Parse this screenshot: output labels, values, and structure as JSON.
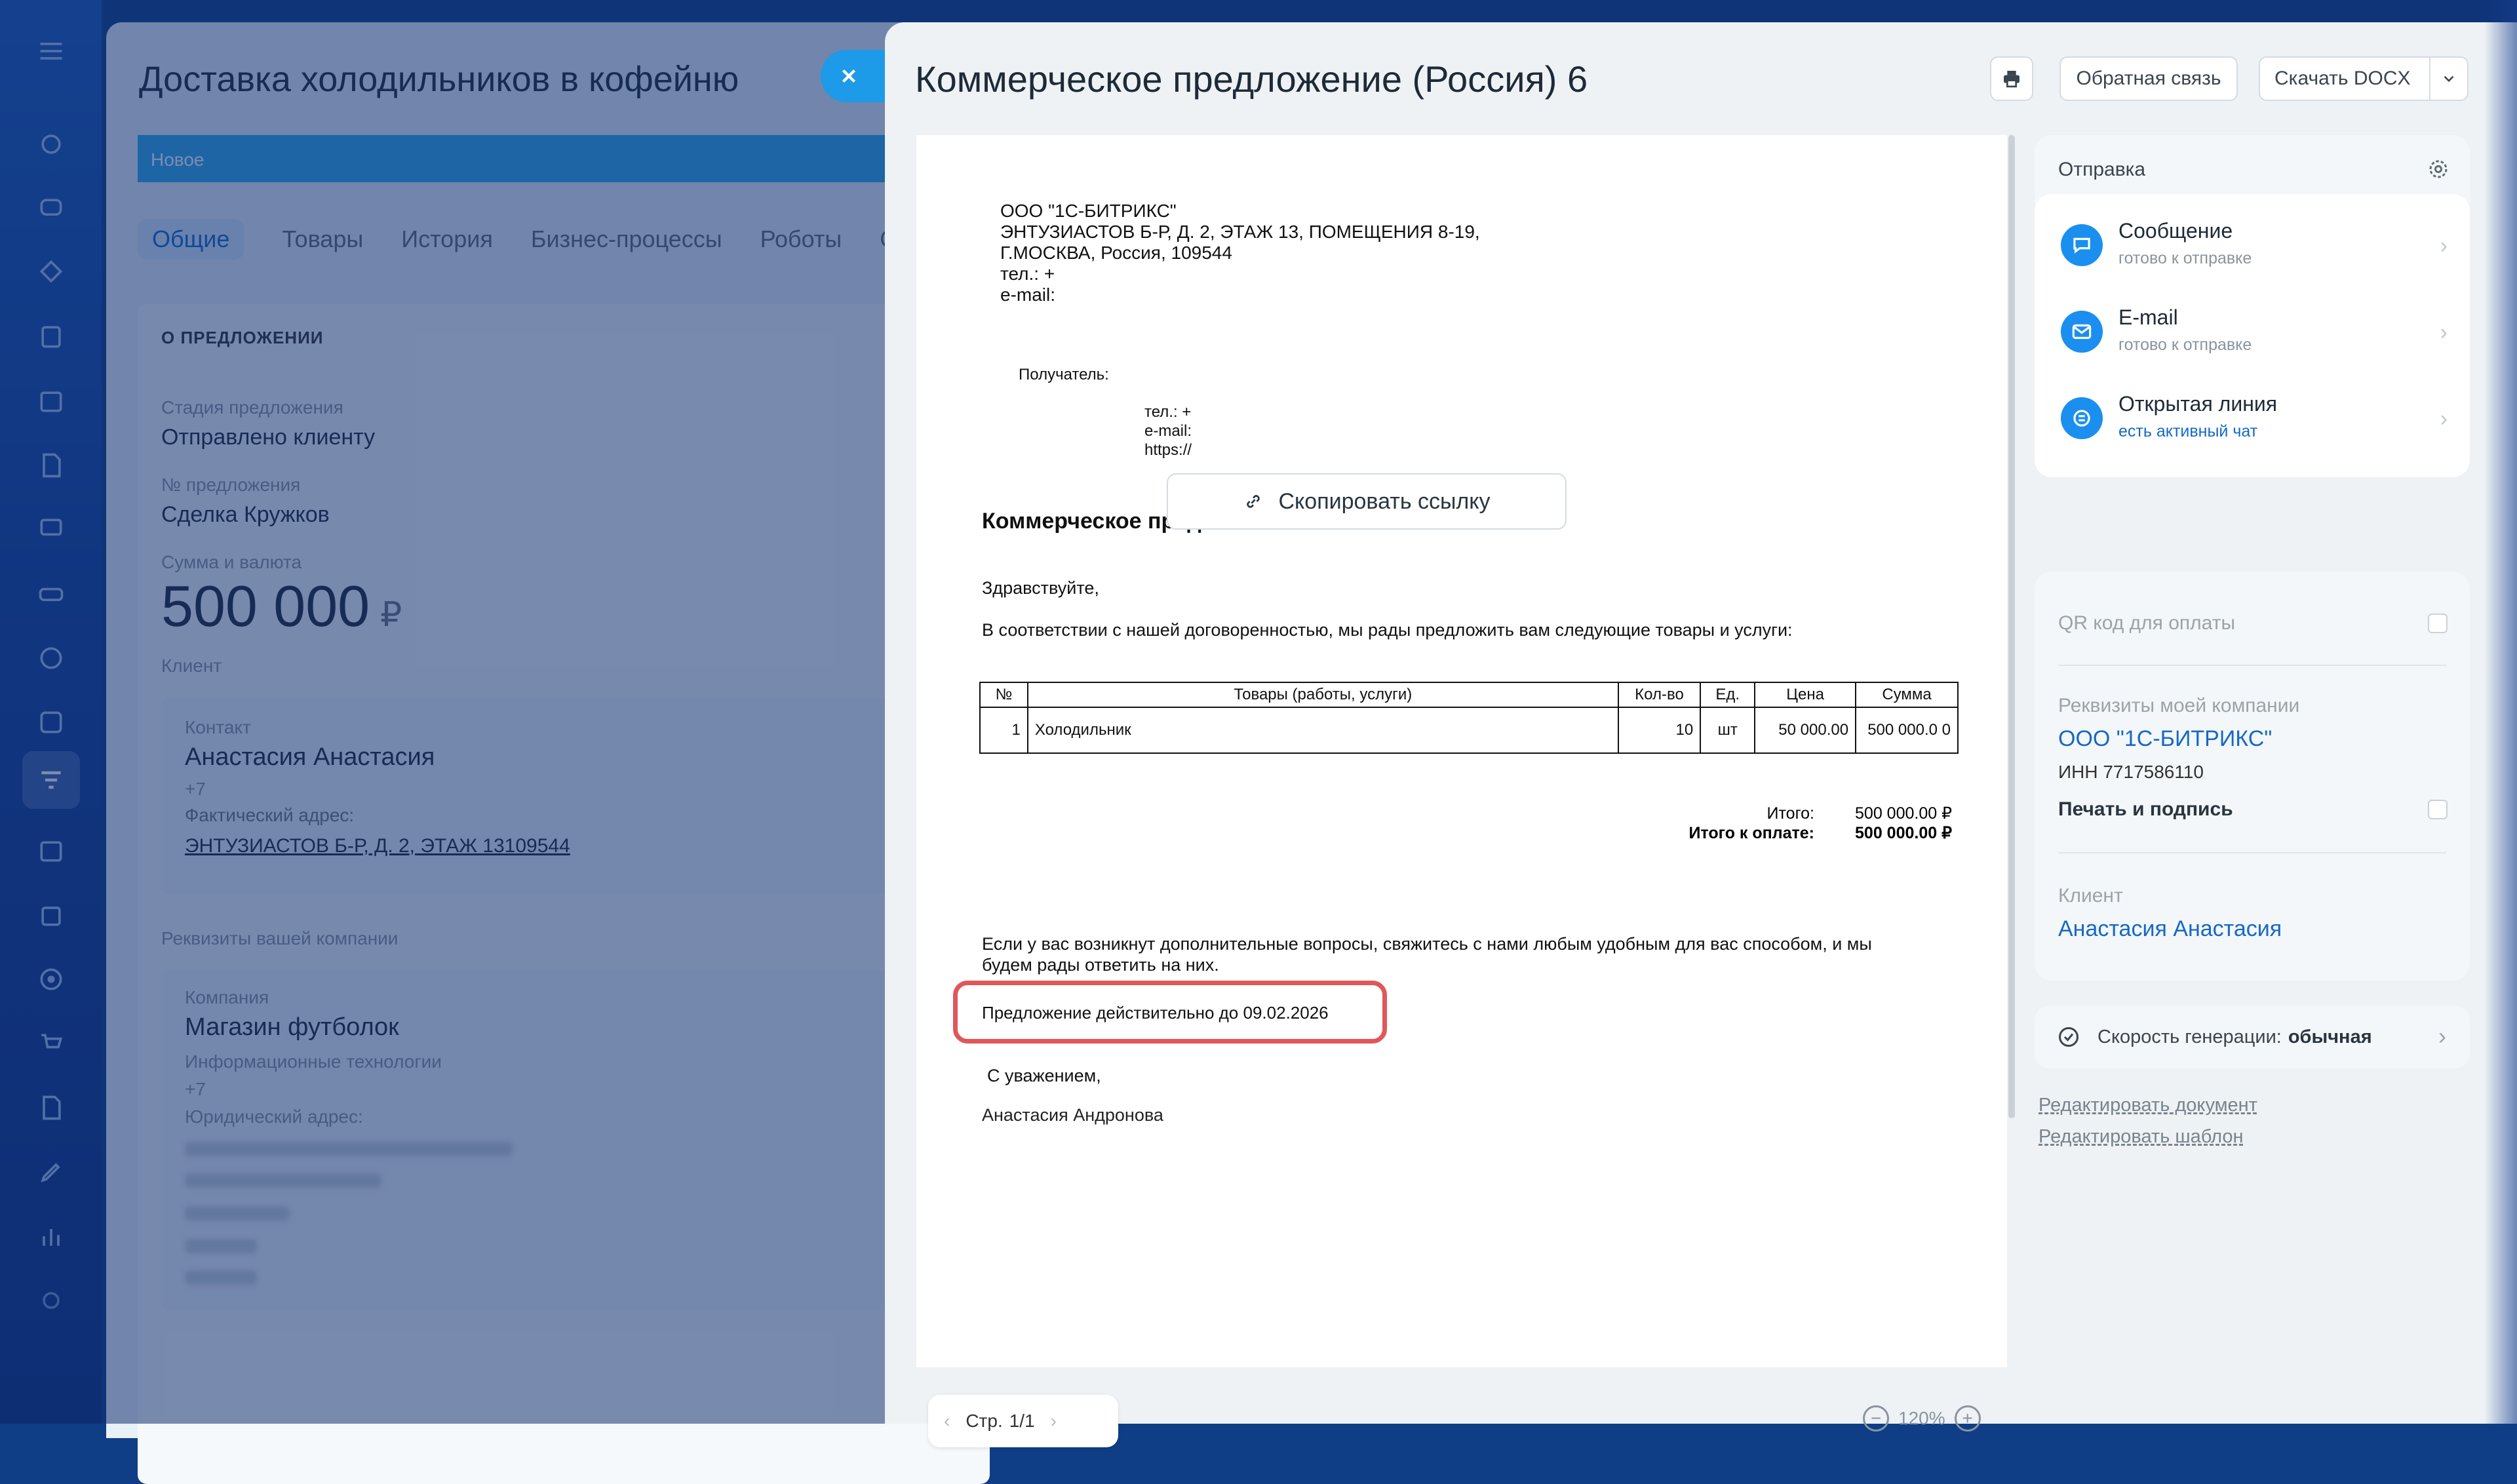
{
  "deal": {
    "title": "Доставка холодильников в кофейню",
    "stage": "Новое",
    "tabs": [
      "Общие",
      "Товары",
      "История",
      "Бизнес-процессы",
      "Роботы",
      "Сд"
    ],
    "section_title": "О ПРЕДЛОЖЕНИИ",
    "stage_label": "Стадия предложения",
    "stage_value": "Отправлено клиенту",
    "number_label": "№ предложения",
    "number_value": "Сделка Кружков",
    "sum_label": "Сумма и валюта",
    "sum_value": "500 000",
    "currency": "₽",
    "client_label": "Клиент",
    "contact_label": "Контакт",
    "contact_value": "Анастасия Анастасия",
    "phone": "+7",
    "address_label": "Фактический адрес:",
    "address_value": "ЭНТУЗИАСТОВ Б-Р, Д. 2, ЭТАЖ 13109544",
    "company_section": "Реквизиты вашей компании",
    "company_label": "Компания",
    "company_value": "Магазин футболок",
    "company_industry": "Информационные технологии",
    "company_phone": "+7",
    "legal_address_label": "Юридический адрес:"
  },
  "panel": {
    "title": "Коммерческое предложение (Россия) 6",
    "print_icon": "printer-icon",
    "feedback_label": "Обратная связь",
    "download_label": "Скачать DOCX"
  },
  "document": {
    "sender_lines": [
      "ООО \"1С-БИТРИКС\"",
      "ЭНТУЗИАСТОВ Б-Р, Д. 2, ЭТАЖ 13, ПОМЕЩЕНИЯ 8-19,",
      "Г.МОСКВА, Россия, 109544",
      "тел.: +",
      "e-mail:"
    ],
    "recipient_label": "Получатель:",
    "recipient_lines": [
      "тел.: +",
      "e-mail:",
      "https://"
    ],
    "heading": "Коммерческое предложение № 6 от 06.08.26",
    "greeting": "Здравствуйте,",
    "intro": "В соответствии с нашей договоренностью, мы рады предложить вам следующие товары и услуги:",
    "table": {
      "headers": [
        "№",
        "Товары (работы, услуги)",
        "Кол-во",
        "Ед.",
        "Цена",
        "Сумма"
      ],
      "rows": [
        [
          "1",
          "Холодильник",
          "10",
          "шт",
          "50 000.00",
          "500 000.0 0"
        ]
      ]
    },
    "total_label": "Итого:",
    "total_value": "500 000.00 ₽",
    "due_label": "Итого к оплате:",
    "due_value": "500 000.00 ₽",
    "note_line1": "Если у вас возникнут дополнительные вопросы, свяжитесь с нами любым удобным для вас способом, и мы",
    "note_line2": "будем рады ответить на них.",
    "validity_text": "Предложение действительно до",
    "validity_date": "09.02.2026",
    "regards": "С уважением,",
    "signer": "Анастасия Андронова"
  },
  "pager": {
    "label": "Стр.",
    "page": "1/1"
  },
  "zoom": {
    "value": "120%"
  },
  "sending": {
    "title": "Отправка",
    "items": [
      {
        "title": "Сообщение",
        "status": "готово к отправке",
        "icon": "chat-icon"
      },
      {
        "title": "E-mail",
        "status": "готово к отправке",
        "icon": "mail-icon"
      },
      {
        "title": "Открытая линия",
        "status": "есть активный чат",
        "icon": "open-line-icon"
      }
    ],
    "copy_link": "Скопировать ссылку"
  },
  "props": {
    "qr_label": "QR код для оплаты",
    "requisites_label": "Реквизиты моей компании",
    "company_name": "ООО \"1С-БИТРИКС\"",
    "inn": "ИНН 7717586110",
    "stamp_label": "Печать и подпись",
    "client_label": "Клиент",
    "client_name": "Анастасия Анастасия"
  },
  "speed": {
    "label": "Скорость генерации:",
    "value": "обычная"
  },
  "links": {
    "edit_document": "Редактировать документ",
    "edit_template": "Редактировать шаблон"
  },
  "colors": {
    "accent": "#1a8ff0",
    "highlight": "#e0575b",
    "stage_bar": "#2fa8ec"
  }
}
